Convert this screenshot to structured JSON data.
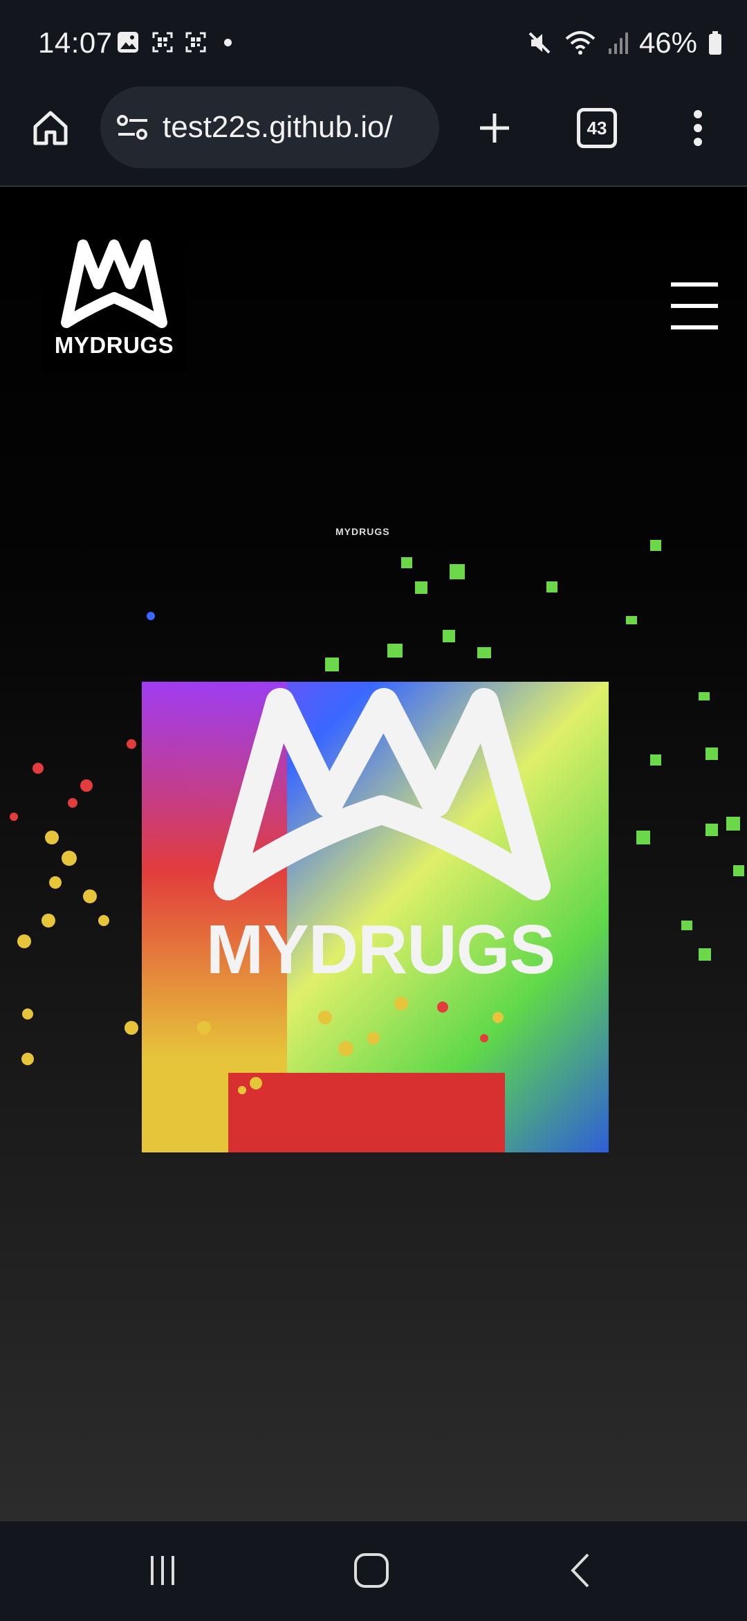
{
  "status_bar": {
    "time": "14:07",
    "battery": "46%",
    "icons_left": [
      "gallery-icon",
      "qr-icon",
      "qr-icon",
      "dot-icon"
    ],
    "icons_right": [
      "mute-icon",
      "wifi-icon",
      "signal-icon",
      "battery-icon"
    ]
  },
  "browser": {
    "url": "test22s.github.io/",
    "tab_count": "43",
    "icons": [
      "home-icon",
      "site-settings-icon",
      "new-tab-icon",
      "tabs-icon",
      "more-icon"
    ]
  },
  "site": {
    "logo_text": "MYDRUGS",
    "hero_logo_text": "MYDRUGS",
    "hero_small_text": "MYDRUGS",
    "menu_icon": "hamburger-icon"
  },
  "nav": {
    "icons": [
      "recents-icon",
      "home-nav-icon",
      "back-icon"
    ]
  },
  "colors": {
    "chrome_bg": "#13161c",
    "url_pill_bg": "#23272f",
    "page_bg": "#000000"
  }
}
